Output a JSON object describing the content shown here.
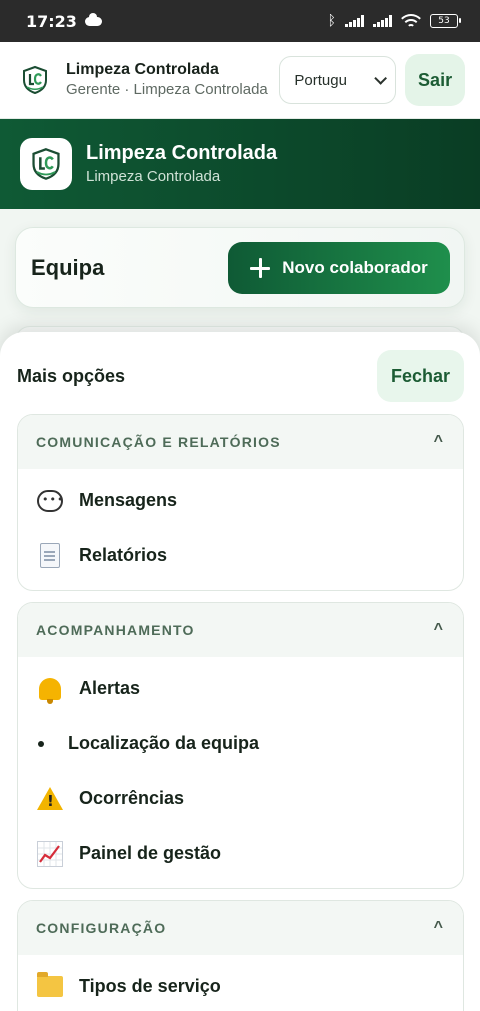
{
  "status_bar": {
    "time": "17:23",
    "battery": "53"
  },
  "header": {
    "app_name": "Limpeza Controlada",
    "subtitle": "Gerente · Limpeza Controlada",
    "language_value": "Português",
    "logout_label": "Sair"
  },
  "banner": {
    "title": "Limpeza Controlada",
    "subtitle": "Limpeza Controlada"
  },
  "team": {
    "title": "Equipa",
    "new_button_label": "Novo colaborador"
  },
  "sheet": {
    "title": "Mais opções",
    "close_label": "Fechar",
    "sections": [
      {
        "label": "COMUNICAÇÃO E RELATÓRIOS",
        "caret": "^",
        "items": [
          {
            "label": "Mensagens",
            "icon": "speech-bubble-icon"
          },
          {
            "label": "Relatórios",
            "icon": "document-icon"
          }
        ]
      },
      {
        "label": "ACOMPANHAMENTO",
        "caret": "^",
        "items": [
          {
            "label": "Alertas",
            "icon": "bell-icon"
          },
          {
            "label": "Localização da equipa",
            "icon": "bullet-icon"
          },
          {
            "label": "Ocorrências",
            "icon": "warning-icon"
          },
          {
            "label": "Painel de gestão",
            "icon": "chart-increasing-icon"
          }
        ]
      },
      {
        "label": "CONFIGURAÇÃO",
        "caret": "^",
        "items": [
          {
            "label": "Tipos de serviço",
            "icon": "folder-icon"
          }
        ]
      }
    ]
  },
  "colors": {
    "brand_dark": "#0a3d24",
    "brand": "#0f5a35",
    "accent": "#1f8f4c",
    "soft_green": "#e4f4e8"
  }
}
